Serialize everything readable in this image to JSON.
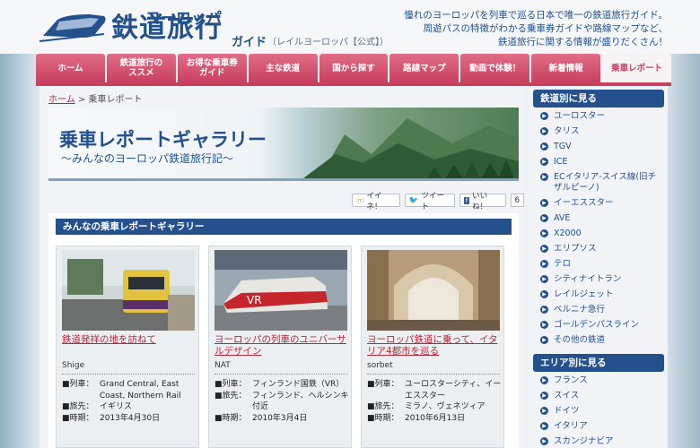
{
  "header": {
    "logo_kana": "ヨーロッパ",
    "logo_main": "鉄道旅行",
    "logo_guide": "ガイド",
    "logo_sub": "（レイルヨーロッパ【公式】）",
    "tagline": [
      "憧れのヨーロッパを列車で巡る日本で唯一の鉄道旅行ガイド。",
      "周遊パスの特徴がわかる乗車券ガイドや路線マップなど、",
      "鉄道旅行に関する情報が盛りだくさん！"
    ]
  },
  "nav": [
    {
      "label": "ホーム"
    },
    {
      "label": "鉄道旅行の\nススメ"
    },
    {
      "label": "お得な乗車券\nガイド"
    },
    {
      "label": "主な鉄道"
    },
    {
      "label": "国から探す"
    },
    {
      "label": "路線マップ"
    },
    {
      "label": "動画で体験！"
    },
    {
      "label": "新着情報"
    },
    {
      "label": "乗車レポート"
    }
  ],
  "breadcrumb": {
    "home": "ホーム",
    "sep": ">",
    "current": "乗車レポート"
  },
  "banner": {
    "title": "乗車レポートギャラリー",
    "subtitle": "〜みんなのヨーロッパ鉄道旅行記〜"
  },
  "social": {
    "mixi": "イイネ！",
    "tweet": "ツイート",
    "like": "いいね！",
    "like_count": "6"
  },
  "gallery": {
    "heading": "みんなの乗車レポートギャラリー",
    "cards": [
      {
        "title": "鉄道発祥の地を訪ねて",
        "author": "Shige",
        "meta": [
          {
            "k": "■列車：",
            "v": "Grand Central, East Coast, Northern Rail"
          },
          {
            "k": "■旅先：",
            "v": "イギリス"
          },
          {
            "k": "■時期：",
            "v": "2013年4月30日"
          }
        ]
      },
      {
        "title": "ヨーロッパの列車のユニバーサルデザイン",
        "author": "NAT",
        "meta": [
          {
            "k": "■列車：",
            "v": "フィンランド国鉄（VR）"
          },
          {
            "k": "■旅先：",
            "v": "フィンランド、ヘルシンキ付近"
          },
          {
            "k": "■時期：",
            "v": "2010年3月4日"
          }
        ]
      },
      {
        "title": "ヨーロッパ鉄道に乗って、イタリア4都市を巡る",
        "author": "sorbet",
        "meta": [
          {
            "k": "■列車：",
            "v": "ユーロスターシティ、イーエススター"
          },
          {
            "k": "■旅先：",
            "v": "ミラノ、ヴェネツィア"
          },
          {
            "k": "■時期：",
            "v": "2010年6月13日"
          }
        ]
      }
    ]
  },
  "sidebar": {
    "rail_heading": "鉄道別に見る",
    "rail_items": [
      "ユーロスター",
      "タリス",
      "TGV",
      "ICE",
      "ECイタリア-スイス線(旧チザルピーノ)",
      "イーエススター",
      "AVE",
      "X2000",
      "エリプソス",
      "テロ",
      "シティナイトラン",
      "レイルジェット",
      "ベルニナ急行",
      "ゴールデンパスライン",
      "その他の鉄道"
    ],
    "area_heading": "エリア別に見る",
    "area_items": [
      "フランス",
      "スイス",
      "ドイツ",
      "イタリア",
      "スカンジナビア"
    ]
  },
  "colors": {
    "brand_blue": "#24508c",
    "nav_red": "#c9405f",
    "link_red": "#b5273a"
  }
}
